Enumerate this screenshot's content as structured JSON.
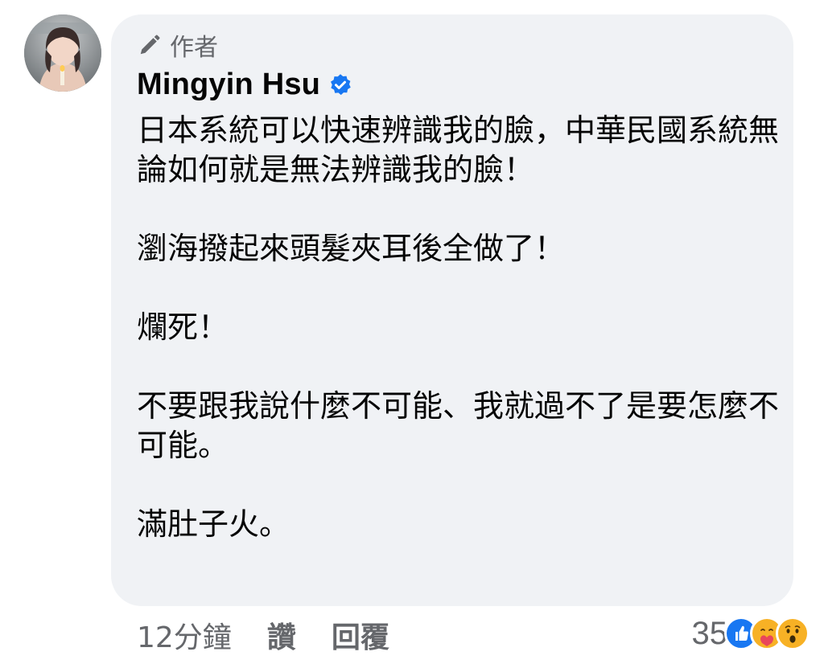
{
  "comment": {
    "author_badge": "作者",
    "author_name": "Mingyin Hsu",
    "paragraphs": [
      "日本系統可以快速辨識我的臉，中華民國系統無論如何就是無法辨識我的臉！",
      "瀏海撥起來頭髮夾耳後全做了！",
      "爛死！",
      "不要跟我說什麼不可能、我就過不了是要怎麼不可能。",
      "滿肚子火。"
    ]
  },
  "actions": {
    "timestamp": "12分鐘",
    "like_label": "讚",
    "reply_label": "回覆"
  },
  "reactions": {
    "count": "35",
    "types": [
      "like-icon",
      "care-icon",
      "wow-icon"
    ]
  },
  "colors": {
    "bubble": "#f0f2f5",
    "secondary_text": "#65676b",
    "verified": "#1877f2"
  }
}
